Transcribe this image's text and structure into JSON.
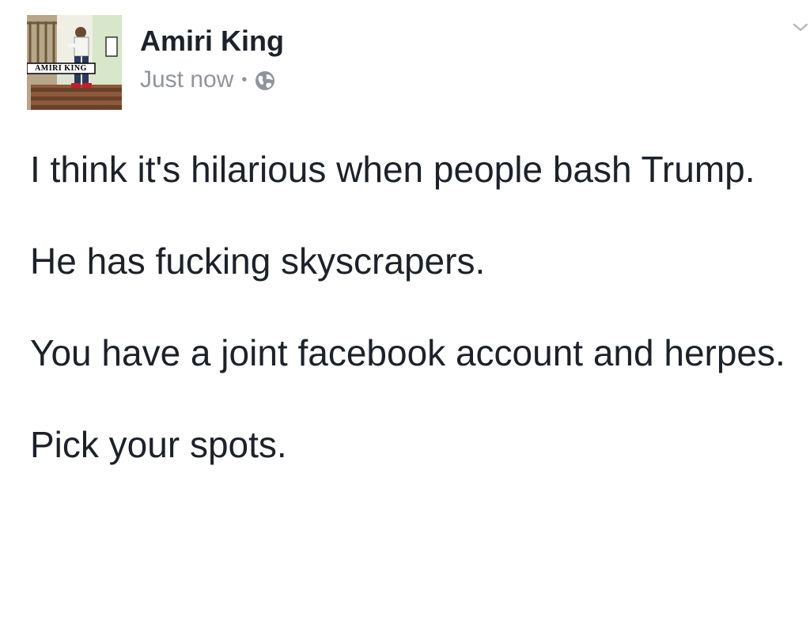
{
  "post": {
    "author": "Amiri King",
    "timestamp": "Just now",
    "separator": "•",
    "privacy_icon": "globe-icon",
    "menu_icon": "chevron-down-icon",
    "avatar": {
      "badge_text": "AMIRI KING"
    },
    "paragraphs": [
      "I think it's hilarious when people bash Trump.",
      "He has fucking skyscrapers.",
      "You have a joint facebook account and herpes.",
      "Pick your spots."
    ]
  },
  "colors": {
    "text_primary": "#1d2129",
    "text_secondary": "#90949c",
    "background": "#ffffff"
  }
}
